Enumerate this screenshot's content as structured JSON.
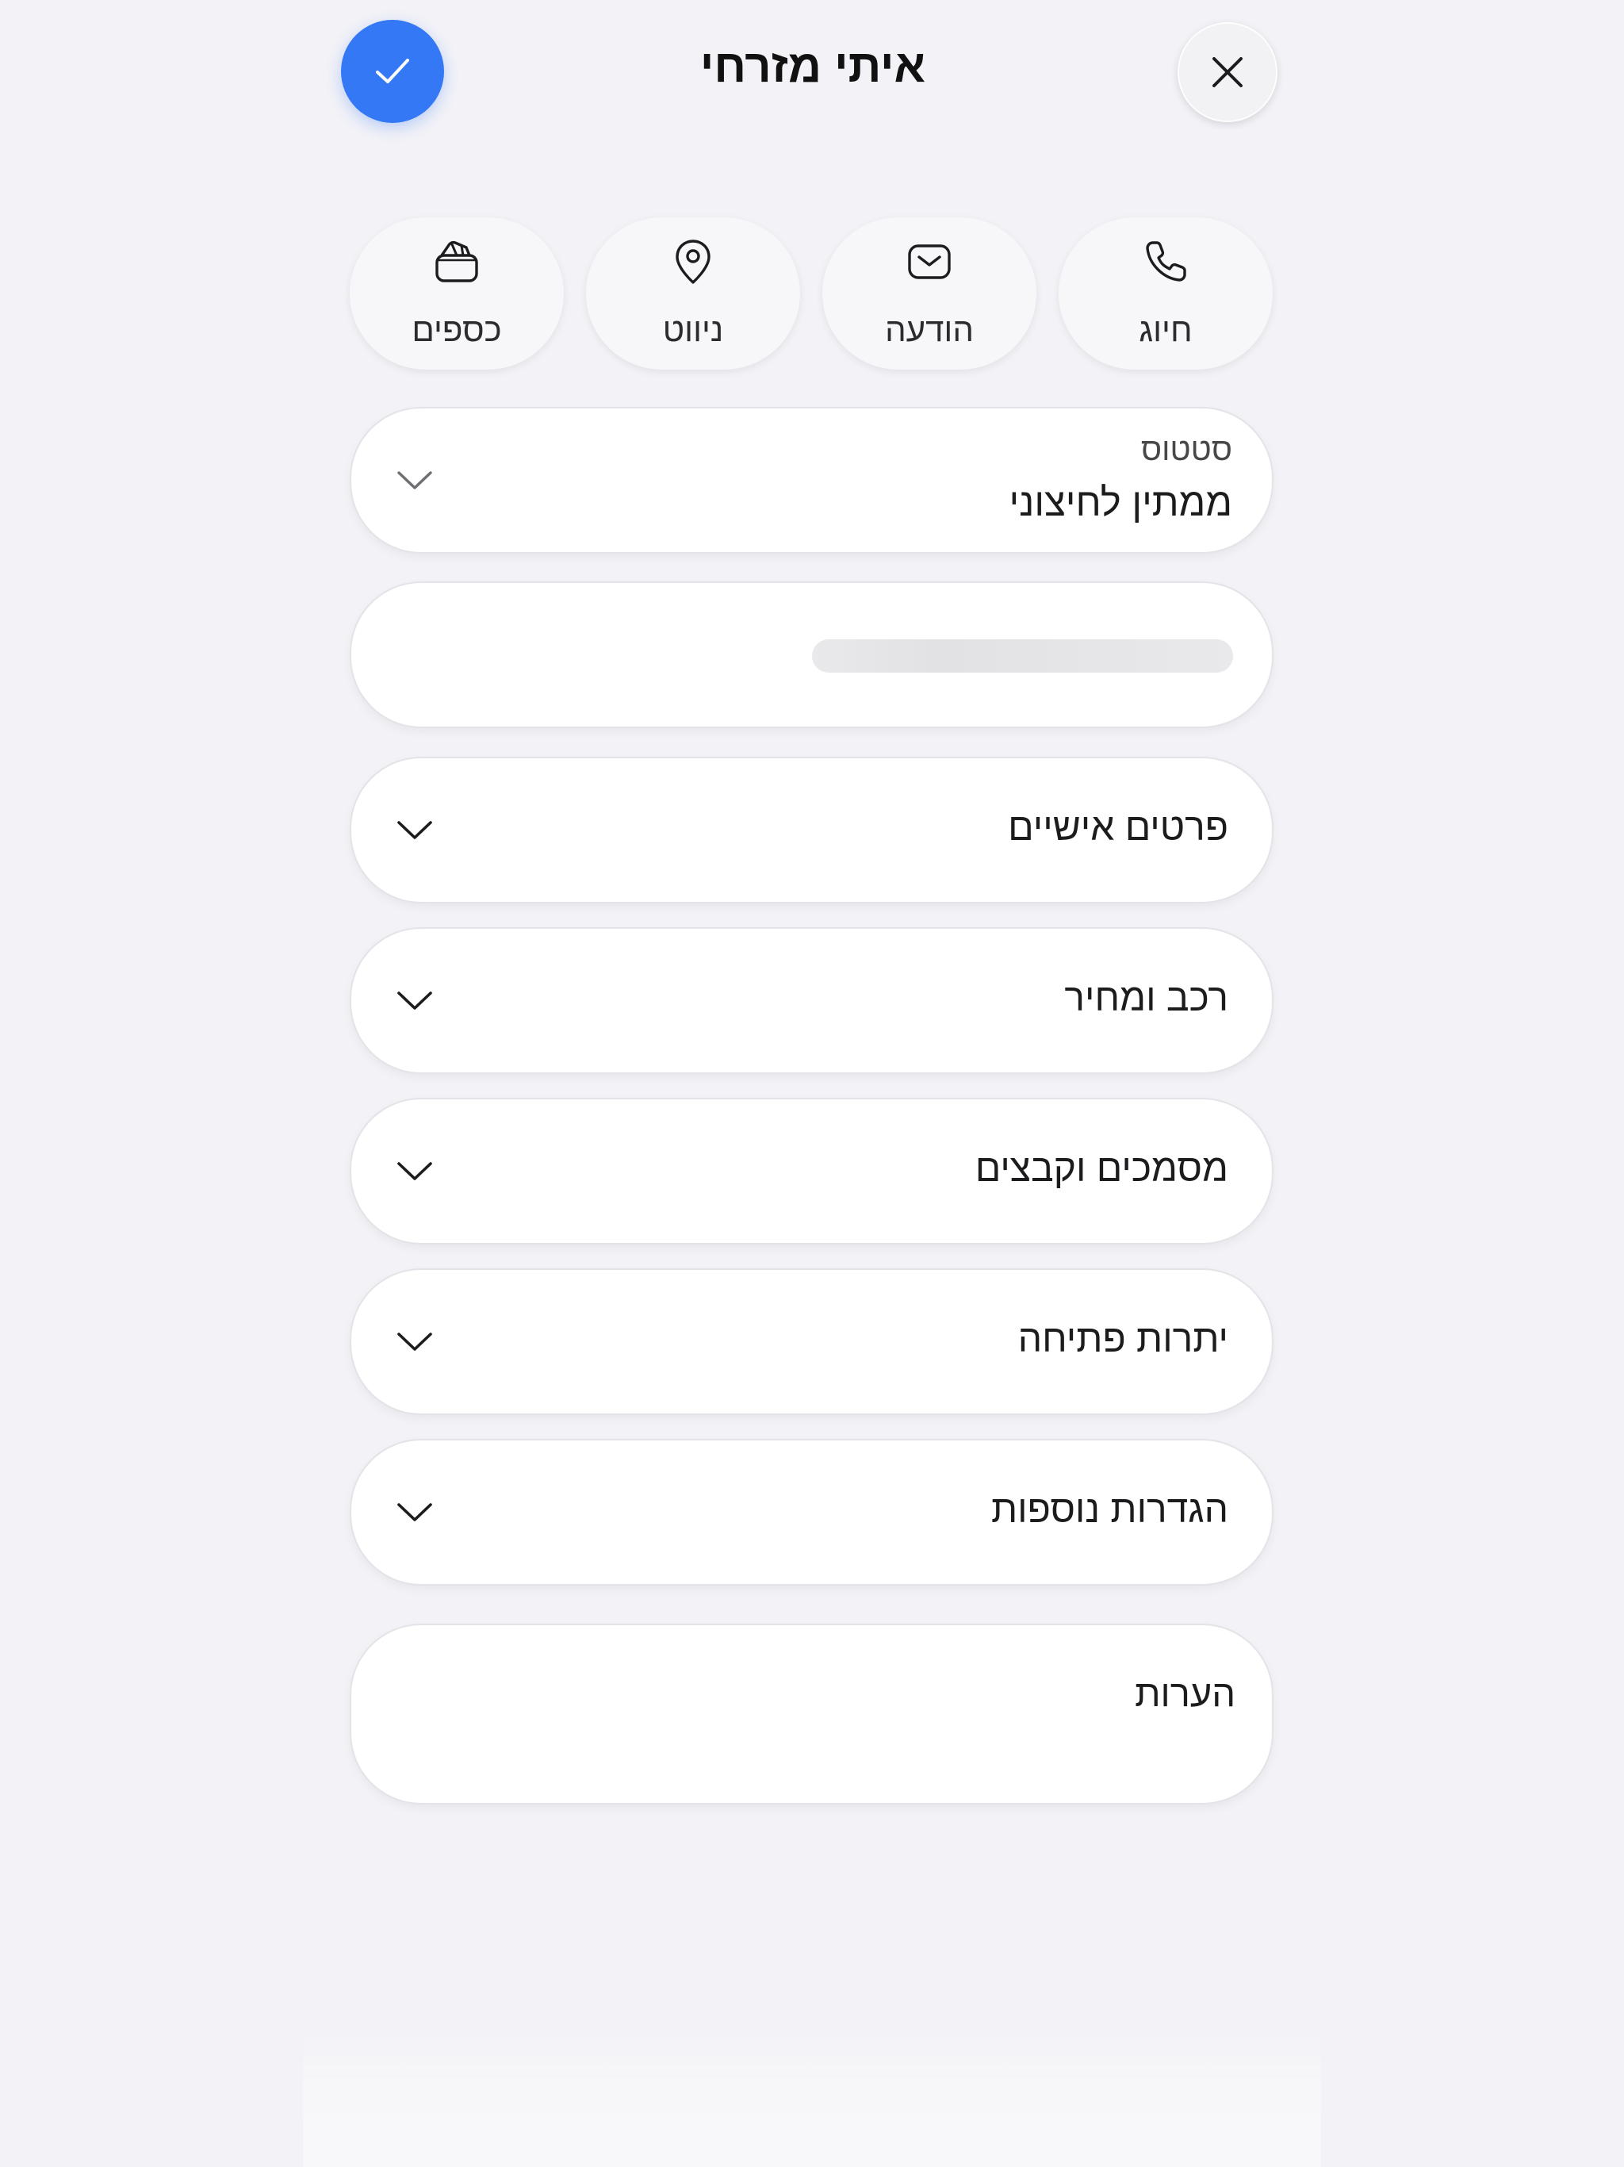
{
  "header": {
    "title": "איתי מזרחי",
    "confirm_icon": "checkmark-icon",
    "close_icon": "close-icon"
  },
  "actions": [
    {
      "label": "חיוג",
      "icon": "phone-icon"
    },
    {
      "label": "הודעה",
      "icon": "message-icon"
    },
    {
      "label": "ניווט",
      "icon": "location-pin-icon"
    },
    {
      "label": "כספים",
      "icon": "wallet-icon"
    }
  ],
  "status": {
    "label": "סטטוס",
    "value": "ממתין לחיצוני"
  },
  "sections": [
    {
      "title": "פרטים אישיים"
    },
    {
      "title": "רכב ומחיר"
    },
    {
      "title": "מסמכים וקבצים"
    },
    {
      "title": "יתרות פתיחה"
    },
    {
      "title": "הגדרות נוספות"
    }
  ],
  "notes": {
    "label": "הערות"
  },
  "colors": {
    "accent": "#3478f6",
    "background": "#f2f2f7",
    "card": "#ffffff"
  }
}
